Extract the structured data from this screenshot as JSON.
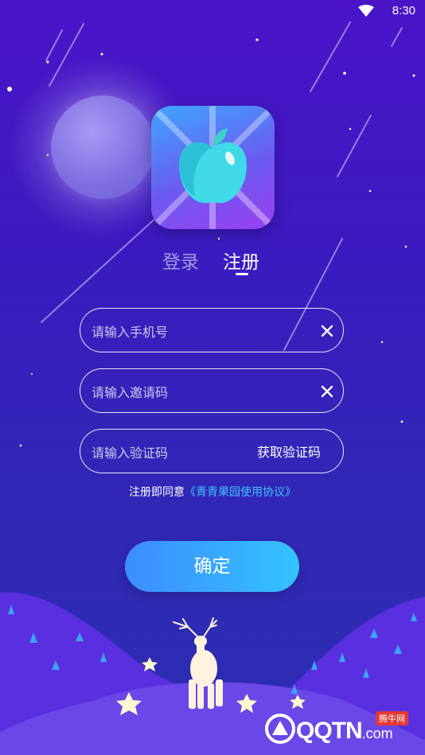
{
  "status_bar": {
    "time": "8:30"
  },
  "tabs": {
    "login": "登录",
    "register": "注册"
  },
  "form": {
    "phone_placeholder": "请输入手机号",
    "invite_placeholder": "请输入邀请码",
    "code_placeholder": "请输入验证码",
    "get_code_label": "获取验证码"
  },
  "agreement": {
    "prefix": "注册即同意",
    "link": "《青青果园使用协议》"
  },
  "confirm_label": "确定",
  "watermark": {
    "text": "QQTN",
    "suffix": ".com",
    "badge": "腾牛网"
  },
  "colors": {
    "accent_link": "#3ec5ff",
    "button_start": "#3d8cff",
    "button_end": "#34c3ff"
  }
}
